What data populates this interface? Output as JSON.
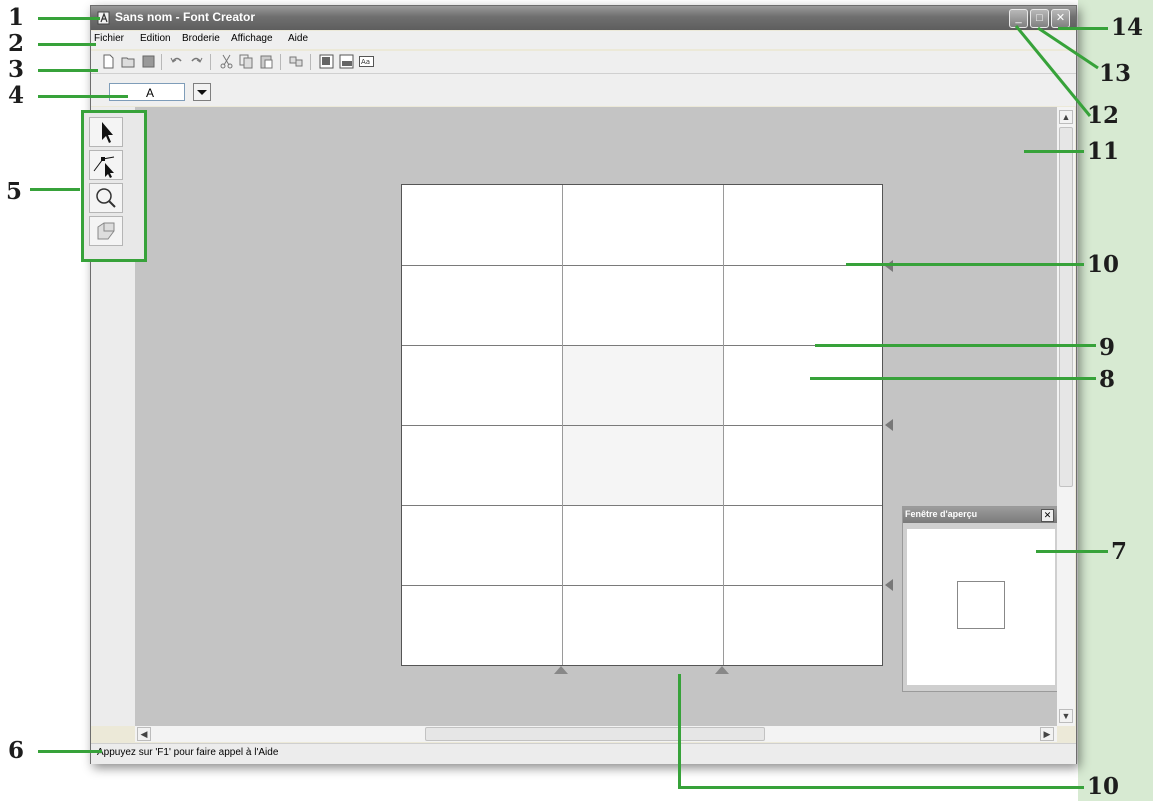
{
  "window": {
    "title": "Sans nom - Font Creator",
    "controls": {
      "minimize": "_",
      "maximize": "□",
      "close": "✕"
    }
  },
  "menu": [
    "Fichier",
    "Edition",
    "Broderie",
    "Affichage",
    "Aide"
  ],
  "toolbar_icons": [
    "new-icon",
    "open-icon",
    "save-icon",
    "undo-icon",
    "redo-icon",
    "cut-icon",
    "copy-icon",
    "paste-icon",
    "special-icon",
    "view-icon-1",
    "view-icon-2",
    "text-view-icon"
  ],
  "character_select": {
    "value": "A"
  },
  "tools": [
    "select-arrow-icon",
    "point-edit-icon",
    "zoom-icon",
    "pan-icon"
  ],
  "preview": {
    "title": "Fenêtre d'aperçu",
    "close": "✕"
  },
  "scrollbars": {
    "up": "▲",
    "down": "▼",
    "left": "◀",
    "right": "▶"
  },
  "status": {
    "text": "Appuyez sur 'F1' pour faire appel à l'Aide"
  },
  "callouts": [
    "1",
    "2",
    "3",
    "4",
    "5",
    "6",
    "7",
    "8",
    "9",
    "10",
    "11",
    "12",
    "13",
    "14",
    "10"
  ],
  "colors": {
    "callout_line": "#37a23a",
    "backdrop": "#d7ead2"
  }
}
